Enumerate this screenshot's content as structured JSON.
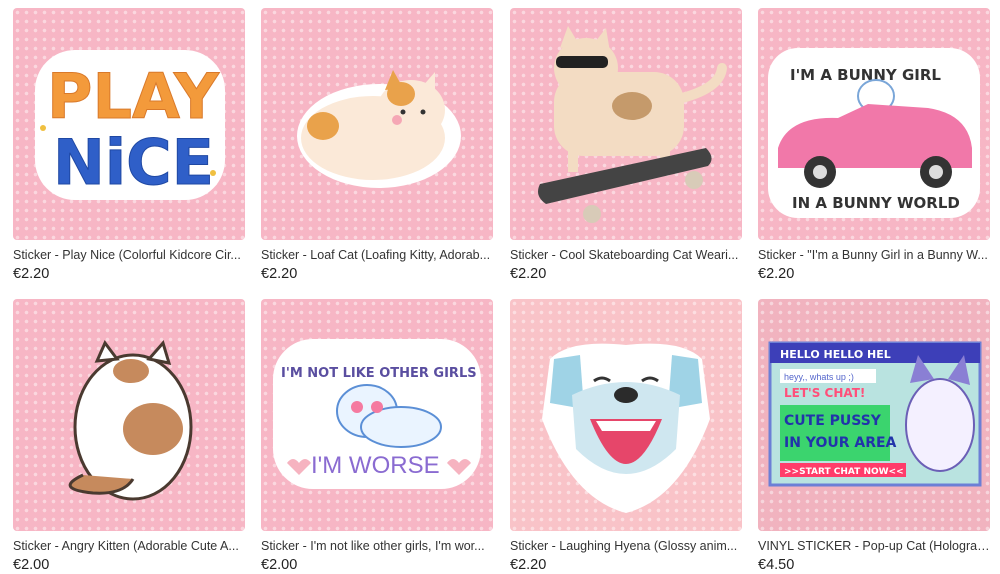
{
  "products": [
    {
      "title": "Sticker - Play Nice (Colorful Kidcore Cir...",
      "price": "€2.20",
      "art_text": [
        "PLAY",
        "NiCE"
      ]
    },
    {
      "title": "Sticker - Loaf Cat (Loafing Kitty, Adorab...",
      "price": "€2.20"
    },
    {
      "title": "Sticker - Cool Skateboarding Cat Weari...",
      "price": "€2.20"
    },
    {
      "title": "Sticker - \"I'm a Bunny Girl in a Bunny W...",
      "price": "€2.20",
      "art_text": [
        "I'M A BUNNY GIRL",
        "IN A BUNNY WORLD"
      ]
    },
    {
      "title": "Sticker - Angry Kitten (Adorable Cute A...",
      "price": "€2.00"
    },
    {
      "title": "Sticker - I'm not like other girls, I'm wor...",
      "price": "€2.00",
      "art_text": [
        "I'M NOT LIKE OTHER GIRLS",
        "I'M WORSE"
      ]
    },
    {
      "title": "Sticker - Laughing Hyena (Glossy anim...",
      "price": "€2.20"
    },
    {
      "title": "VINYL STICKER - Pop-up Cat (Holograp...",
      "price": "€4.50",
      "art_text": [
        "HELLO HELLO HEL",
        "heyy,, whats up ;)",
        "LET'S CHAT!",
        "CUTE PUSSY",
        "IN YOUR AREA",
        ">>START CHAT NOW<<"
      ]
    }
  ],
  "colors": {
    "thumb_bg": "#f7b6c5",
    "price": "#222222"
  }
}
